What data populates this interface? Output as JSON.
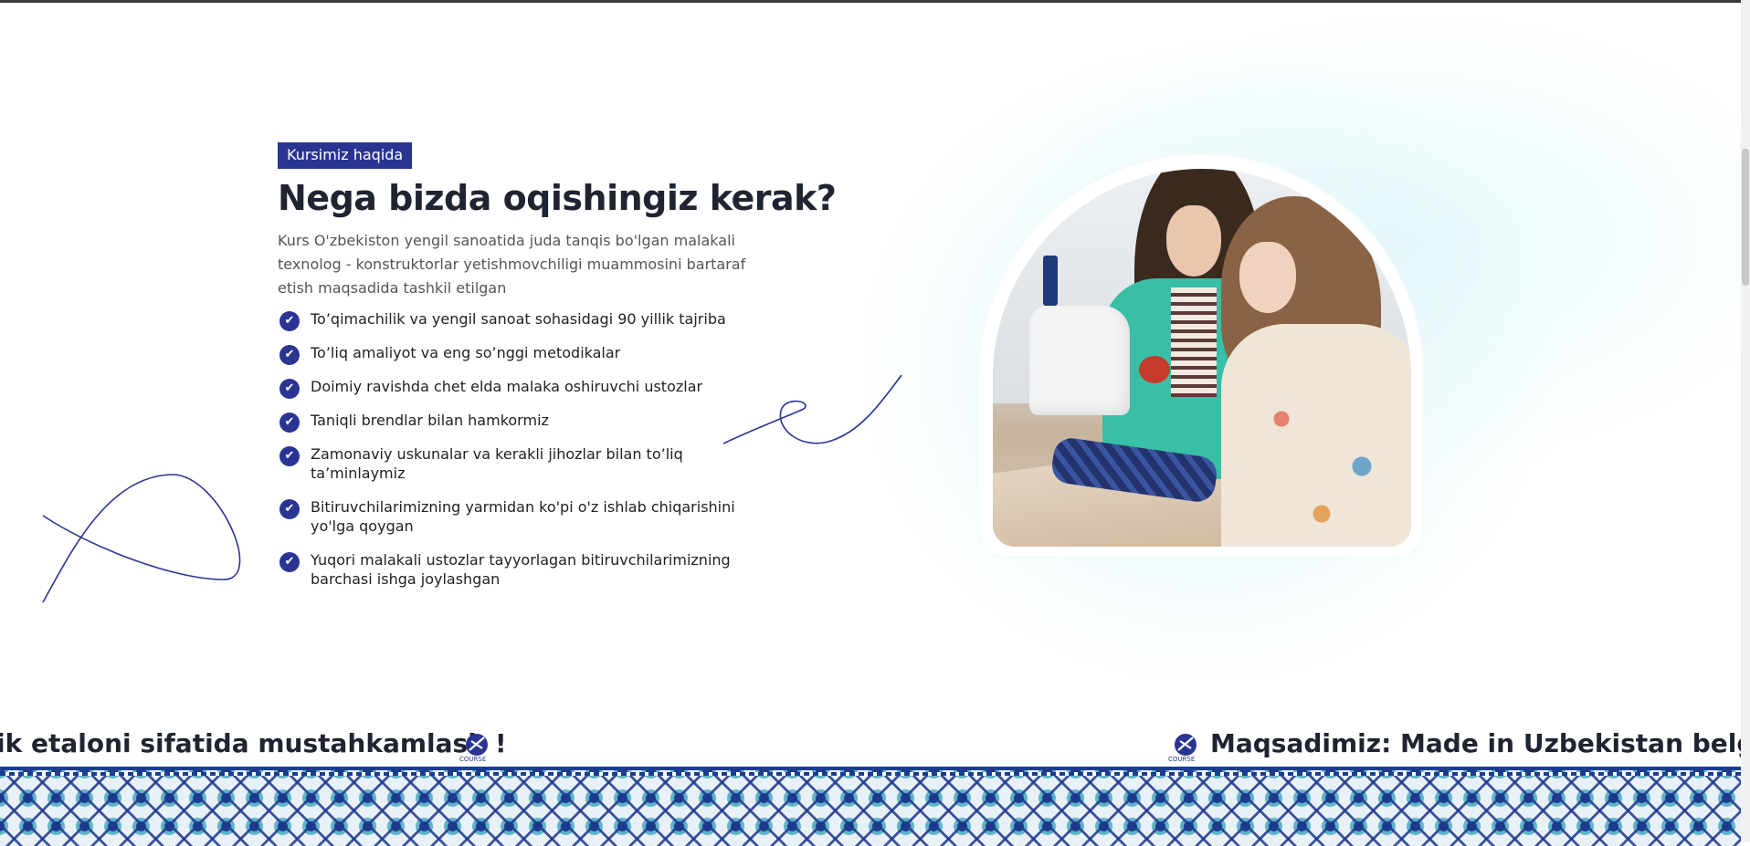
{
  "about": {
    "badge": "Kursimiz haqida",
    "heading": "Nega bizda oqishingiz kerak?",
    "description": "Kurs O'zbekiston yengil sanoatida juda tanqis bo'lgan malakali texnolog - konstruktorlar yetishmovchiligi muammosini bartaraf etish maqsadida tashkil etilgan",
    "features": [
      "To’qimachilik va yengil sanoat sohasidagi 90 yillik tajriba",
      "To’liq amaliyot va eng so’nggi metodikalar",
      "Doimiy ravishda chet elda malaka oshiruvchi ustozlar",
      "Taniqli brendlar bilan hamkormiz",
      "Zamonaviy uskunalar va kerakli jihozlar bilan to’liq ta’minlaymiz",
      "Bitiruvchilarimizning yarmidan ko'pi o'z ishlab chiqarishini yo'lga qoygan",
      "Yuqori malakali ustozlar tayyorlagan bitiruvchilarimizning barchasi ishga joylashgan"
    ],
    "check_icon": "check-circle-icon",
    "image_alt_icon": "sewing-students-photo"
  },
  "marquee": {
    "text_left": "ik etaloni sifatida mustahkamlash !",
    "text_right": "Maqsadimiz: Made in Uzbekistan belgisin",
    "logo_icon": "course-logo-icon"
  },
  "colors": {
    "accent": "#2a3593",
    "heading": "#1e2430",
    "glow": "#96e1eb"
  }
}
